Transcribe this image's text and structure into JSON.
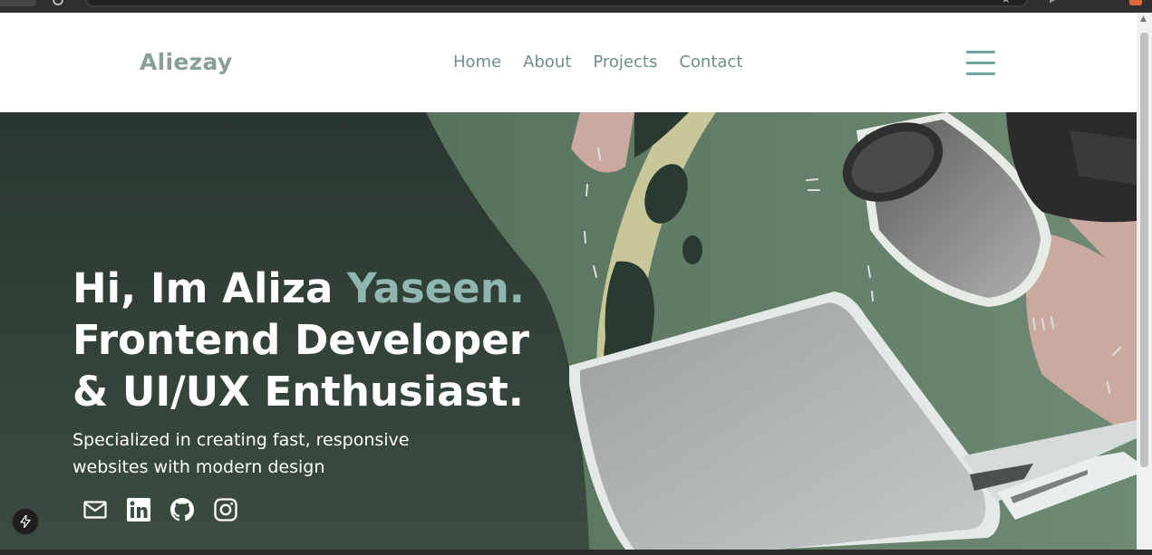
{
  "site": {
    "logo": "Aliezay",
    "nav": [
      "Home",
      "About",
      "Projects",
      "Contact"
    ]
  },
  "hero": {
    "line1_prefix": "Hi, Im Aliza ",
    "line1_accent": "Yaseen.",
    "line2": "Frontend Developer",
    "line3": "& UI/UX Enthusiast.",
    "subline": "Specialized in creating fast, responsive websites with modern design",
    "socials": [
      "mail-icon",
      "linkedin-icon",
      "github-icon",
      "instagram-icon"
    ]
  },
  "colors": {
    "accent": "#8fb7b0",
    "logo": "#8a9e99",
    "nav": "#6f8e8a",
    "hero_dark": "#2c3a31",
    "hero_green": "#4f6a55"
  }
}
